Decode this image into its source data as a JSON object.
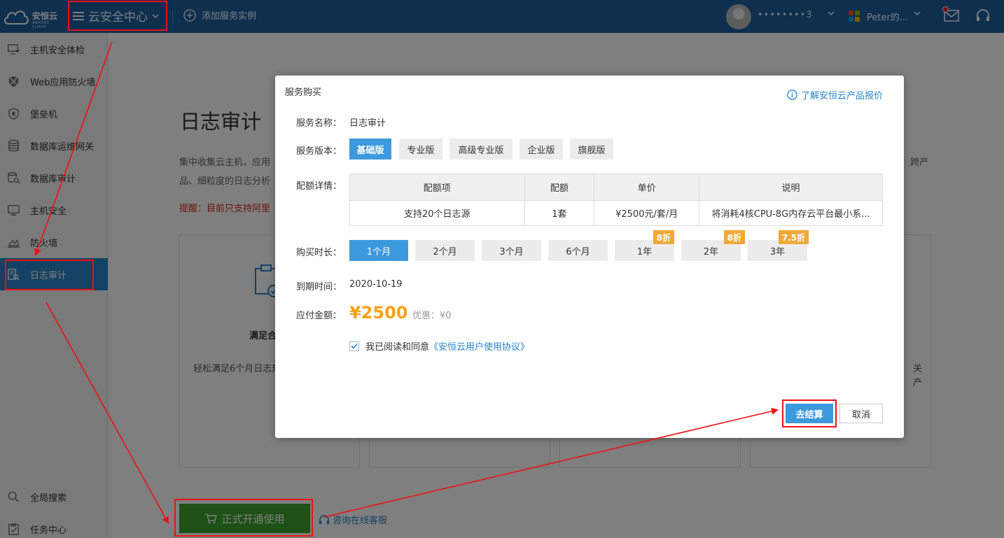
{
  "topbar": {
    "logo_text": "安恒云",
    "logo_sub": "ANHENG CLOUD",
    "menu_title": "云安全中心",
    "add_service": "添加服务实例",
    "account": "••••••••3",
    "org": "Peter的..."
  },
  "sidebar": {
    "items": [
      {
        "label": "主机安全体检",
        "icon": "host-check-icon"
      },
      {
        "label": "Web应用防火墙",
        "icon": "waf-icon"
      },
      {
        "label": "堡垒机",
        "icon": "bastion-icon"
      },
      {
        "label": "数据库运维网关",
        "icon": "database-icon"
      },
      {
        "label": "数据库审计",
        "icon": "db-audit-icon"
      },
      {
        "label": "主机安全",
        "icon": "monitor-icon"
      },
      {
        "label": "防火墙",
        "icon": "firewall-icon"
      },
      {
        "label": "日志审计",
        "icon": "log-audit-icon"
      }
    ],
    "bottom": [
      {
        "label": "全局搜索",
        "icon": "search-icon"
      },
      {
        "label": "任务中心",
        "icon": "task-icon"
      }
    ]
  },
  "main": {
    "title": "日志审计",
    "intro_line1_start": "集中收集云主机，应用",
    "intro_line1_end": "跨产",
    "intro_line2": "品、细粒度的日志分析",
    "warning": "提醒：目前只支持阿里",
    "card1_title": "满足合",
    "card1_desc": "轻松满足6个月日志规要求。",
    "card4_fragment_1": "关",
    "card4_fragment_2": "产",
    "open_button": "正式开通使用",
    "consult_link": "咨询在线客服"
  },
  "modal": {
    "title": "服务购买",
    "price_link": "了解安恒云产品报价",
    "service_name_label": "服务名称：",
    "service_name": "日志审计",
    "version_label": "服务版本：",
    "versions": [
      "基础版",
      "专业版",
      "高级专业版",
      "企业版",
      "旗舰版"
    ],
    "quota_label": "配额详情：",
    "quota_headers": [
      "配额项",
      "配额",
      "单价",
      "说明"
    ],
    "quota_row": [
      "支持20个日志源",
      "1套",
      "¥2500元/套/月",
      "将消耗4核CPU-8G内存云平台最小系..."
    ],
    "duration_label": "购买时长：",
    "durations": [
      {
        "label": "1个月",
        "badge": ""
      },
      {
        "label": "2个月",
        "badge": ""
      },
      {
        "label": "3个月",
        "badge": ""
      },
      {
        "label": "6个月",
        "badge": ""
      },
      {
        "label": "1年",
        "badge": "8折"
      },
      {
        "label": "2年",
        "badge": "8折"
      },
      {
        "label": "3年",
        "badge": "7.5折"
      }
    ],
    "expire_label": "到期时间：",
    "expire_date": "2020-10-19",
    "amount_label": "应付金额：",
    "amount": "¥2500",
    "discount": "优惠：¥0",
    "agree_text": "我已阅读和同意",
    "agree_link": "《安恒云用户使用协议》",
    "checkout": "去结算",
    "cancel": "取消"
  },
  "colors": {
    "topbar": "#1f5f9e",
    "accent": "#3d99dd",
    "open_button": "#3ba22d",
    "amount": "#f5a21b",
    "badge": "#f0a83a",
    "annotation": "#ee1111"
  }
}
